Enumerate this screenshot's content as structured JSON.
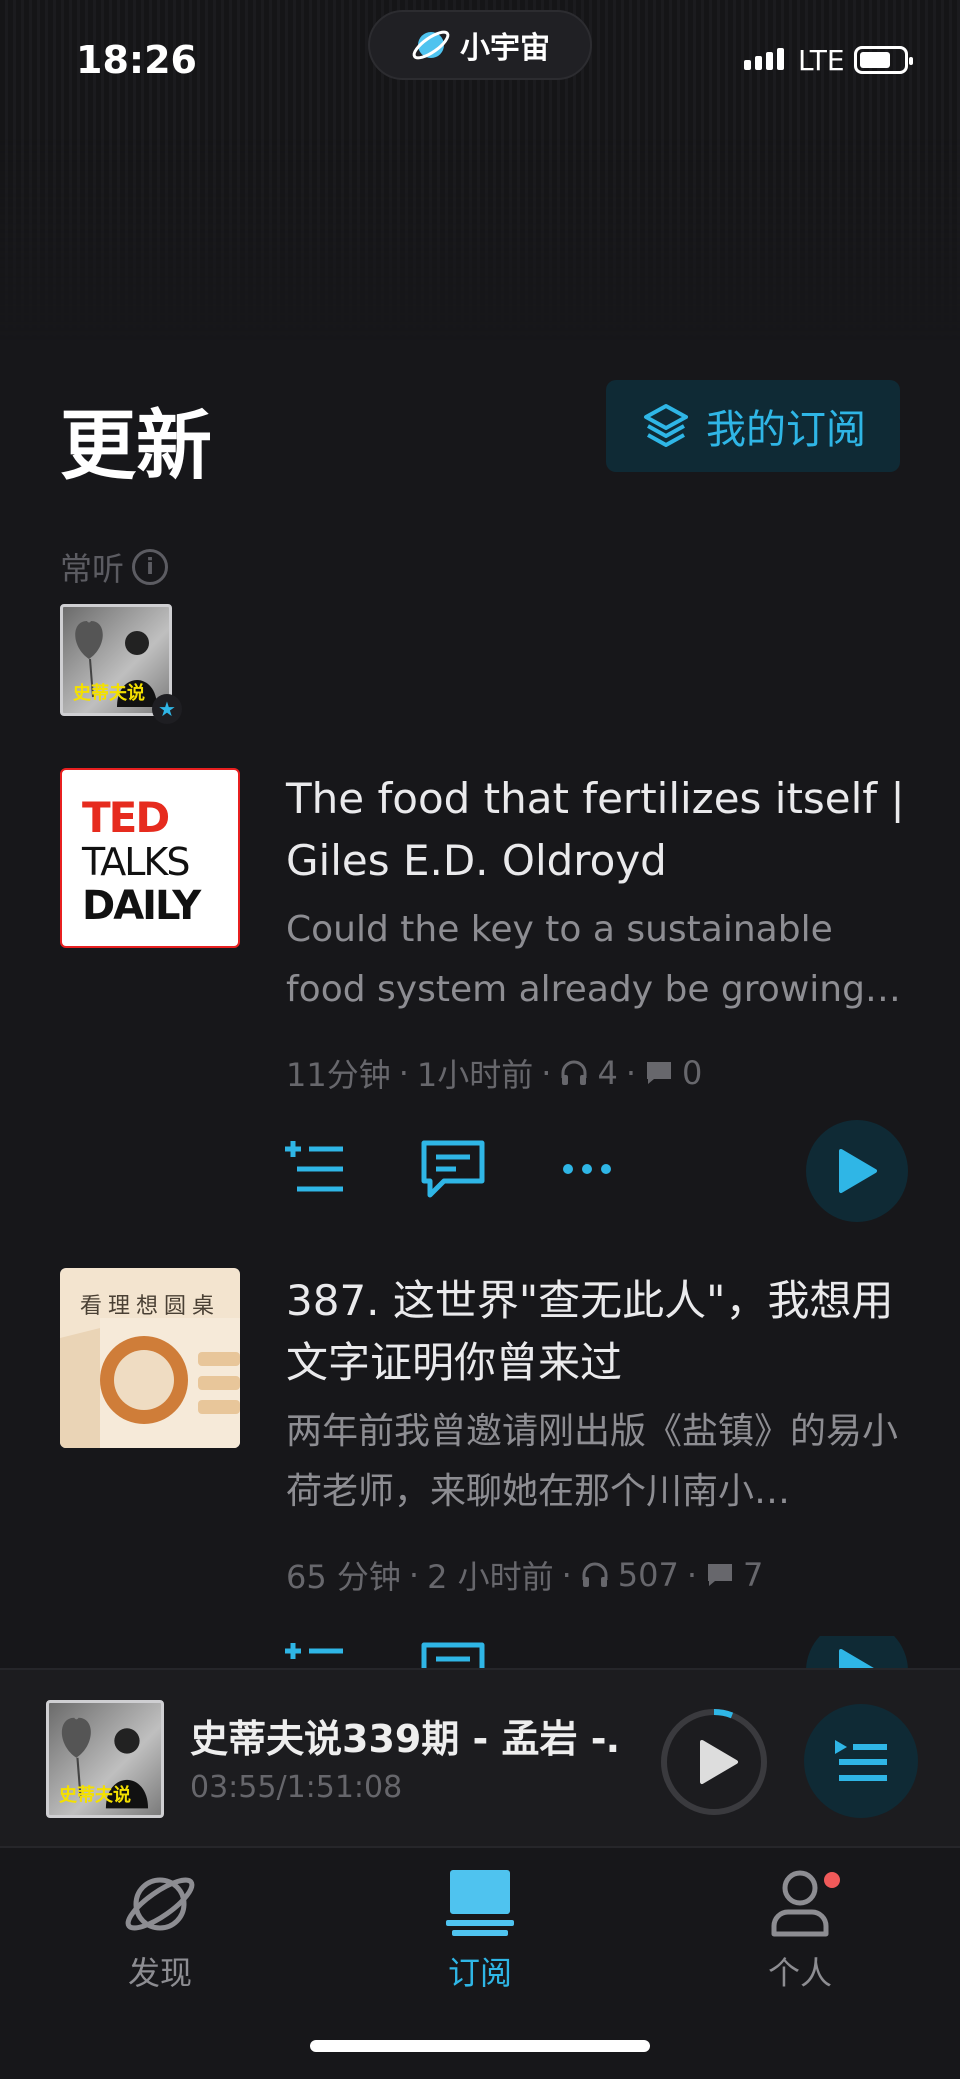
{
  "status": {
    "time": "18:26",
    "network": "LTE"
  },
  "pill": {
    "label": "小宇宙"
  },
  "header": {
    "title": "更新",
    "subscriptions_label": "我的订阅"
  },
  "frequent": {
    "label": "常听",
    "thumb_caption": "史蒂夫说"
  },
  "episodes": [
    {
      "title": "The food that fertilizes itself | Giles E.D. Oldroyd",
      "desc": "Could the key to a sustainable food system already be growing…",
      "duration": "11分钟",
      "ago": "1小时前",
      "plays": "4",
      "comments": "0",
      "cover": {
        "line1": "TED",
        "line2": "TALKS",
        "line3": "DAILY"
      }
    },
    {
      "title": "387. 这世界\"查无此人\"，我想用文字证明你曾来过",
      "desc": "两年前我曾邀请刚出版《盐镇》的易小荷老师，来聊她在那个川南小…",
      "duration": "65 分钟",
      "ago": "2 小时前",
      "plays": "507",
      "comments": "7",
      "cover": {
        "title": "看理想圆桌"
      }
    }
  ],
  "mini_player": {
    "title": "史蒂夫说339期 - 孟岩 -…",
    "time": "03:55/1:51:08",
    "cover_caption": "史蒂夫说"
  },
  "nav": {
    "discover": "发现",
    "subscribe": "订阅",
    "profile": "个人"
  },
  "colors": {
    "accent": "#2fb6e6",
    "background": "#17171a"
  }
}
